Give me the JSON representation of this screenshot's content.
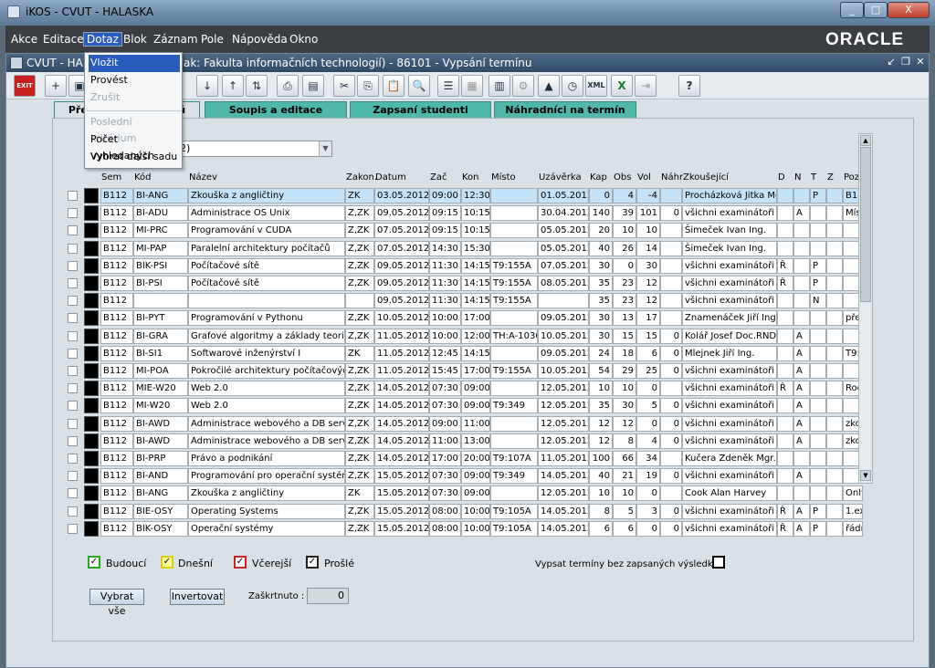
{
  "window": {
    "title": "iKOS - CVUT - HALASKA",
    "min": "_",
    "max": "□",
    "close": "X"
  },
  "menu": [
    "Akce",
    "Editace",
    "Dotaz",
    "Blok",
    "Záznam",
    "Pole",
    "Nápověda",
    "Okno"
  ],
  "brand": "ORACLE",
  "inner": {
    "title": "CVUT - HAL",
    "title2": "ak: Fakulta informačních technologií) - 86101 - Vypsání termínu"
  },
  "tabs": [
    "Přeh",
    "nů",
    "Soupis a editace termínů",
    "Zapsaní studenti",
    "Náhradníci na termín"
  ],
  "dotaz_menu": [
    "Vložit",
    "Provést",
    "Zrušit",
    "Poslední kritérium",
    "Počet vyhledaných",
    "Vybrat další sadu"
  ],
  "combo_value": "2)",
  "columns": [
    "Sem",
    "Kód",
    "Název",
    "Zakon.",
    "Datum",
    "Zač",
    "Kon",
    "Místo",
    "Uzávěrka",
    "Kap",
    "Obs",
    "Vol",
    "Náhr",
    "Zkoušející",
    "D",
    "N",
    "T",
    "Z",
    "Poz"
  ],
  "rows": [
    [
      "B112",
      "BI-ANG",
      "Zkouška z angličtiny",
      "ZK",
      "03.05.2012",
      "09:00",
      "12:30",
      "",
      "01.05.2012",
      "0",
      "4",
      "-4",
      "",
      "Procházková Jitka Mg",
      "",
      "",
      "P",
      "",
      "B1-3"
    ],
    [
      "B112",
      "BI-ADU",
      "Administrace OS Unix",
      "Z,ZK",
      "09.05.2012",
      "09:15",
      "10:15",
      "",
      "30.04.2012",
      "140",
      "39",
      "101",
      "0",
      "všichni examinátoři př",
      "",
      "A",
      "",
      "",
      "Míst"
    ],
    [
      "B112",
      "MI-PRC",
      "Programování v CUDA",
      "Z,ZK",
      "07.05.2012",
      "09:15",
      "10:15",
      "",
      "05.05.2012",
      "20",
      "10",
      "10",
      "",
      "Šimeček Ivan Ing.",
      "",
      "",
      "",
      "",
      ""
    ],
    [
      "B112",
      "MI-PAP",
      "Paralelní architektury počítačů",
      "Z,ZK",
      "07.05.2012",
      "14:30",
      "15:30",
      "",
      "05.05.2012",
      "40",
      "26",
      "14",
      "",
      "Šimeček Ivan Ing.",
      "",
      "",
      "",
      "",
      ""
    ],
    [
      "B112",
      "BIK-PSI",
      "Počítačové sítě",
      "Z,ZK",
      "09.05.2012",
      "11:30",
      "14:15",
      "T9:155A",
      "07.05.2012",
      "30",
      "0",
      "30",
      "",
      "všichni examinátoři př",
      "Ř",
      "",
      "P",
      "",
      ""
    ],
    [
      "B112",
      "BI-PSI",
      "Počítačové sítě",
      "Z,ZK",
      "09.05.2012",
      "11:30",
      "14:15",
      "T9:155A",
      "08.05.2012",
      "35",
      "23",
      "12",
      "",
      "všichni examinátoři př",
      "Ř",
      "",
      "P",
      "",
      ""
    ],
    [
      "B112",
      "",
      "",
      "",
      "09.05.2012",
      "11:30",
      "14:15",
      "T9:155A",
      "",
      "35",
      "23",
      "12",
      "",
      "všichni examinátoři př",
      "",
      "",
      "N",
      "",
      ""
    ],
    [
      "B112",
      "BI-PYT",
      "Programování v Pythonu",
      "Z,ZK",
      "10.05.2012",
      "10:00",
      "17:00",
      "",
      "09.05.2012",
      "30",
      "13",
      "17",
      "",
      "Znamenáček Jiří Ing.",
      "",
      "",
      "",
      "",
      "před"
    ],
    [
      "B112",
      "BI-GRA",
      "Grafové algoritmy a základy teorie",
      "Z,ZK",
      "11.05.2012",
      "10:00",
      "12:00",
      "TH:A-1030",
      "10.05.2012",
      "30",
      "15",
      "15",
      "0",
      "Kolář Josef Doc.RNDr",
      "",
      "A",
      "",
      "",
      ""
    ],
    [
      "B112",
      "BI-SI1",
      "Softwarové inženýrství I",
      "ZK",
      "11.05.2012",
      "12:45",
      "14:15",
      "",
      "09.05.2012",
      "24",
      "18",
      "6",
      "0",
      "Mlejnek Jiří Ing.",
      "",
      "A",
      "",
      "",
      "T9:3"
    ],
    [
      "B112",
      "MI-POA",
      "Pokročilé architektury počítačových",
      "Z,ZK",
      "11.05.2012",
      "15:45",
      "17:00",
      "T9:155A",
      "10.05.2012",
      "54",
      "29",
      "25",
      "0",
      "všichni examinátoři př",
      "",
      "A",
      "",
      "",
      ""
    ],
    [
      "B112",
      "MIE-W20",
      "Web 2.0",
      "Z,ZK",
      "14.05.2012",
      "07:30",
      "09:00",
      "",
      "12.05.2012",
      "10",
      "10",
      "0",
      "",
      "všichni examinátoři př",
      "Ř",
      "A",
      "",
      "",
      "Roo"
    ],
    [
      "B112",
      "MI-W20",
      "Web 2.0",
      "Z,ZK",
      "14.05.2012",
      "07:30",
      "09:00",
      "T9:349",
      "12.05.2012",
      "35",
      "30",
      "5",
      "0",
      "všichni examinátoři př",
      "",
      "A",
      "",
      "",
      ""
    ],
    [
      "B112",
      "BI-AWD",
      "Administrace webového a DB serve",
      "Z,ZK",
      "14.05.2012",
      "09:00",
      "11:00",
      "",
      "12.05.2012",
      "12",
      "12",
      "0",
      "0",
      "všichni examinátoři př",
      "",
      "A",
      "",
      "",
      "zkou"
    ],
    [
      "B112",
      "BI-AWD",
      "Administrace webového a DB serve",
      "Z,ZK",
      "14.05.2012",
      "11:00",
      "13:00",
      "",
      "12.05.2012",
      "12",
      "8",
      "4",
      "0",
      "všichni examinátoři př",
      "",
      "A",
      "",
      "",
      "zkou"
    ],
    [
      "B112",
      "BI-PRP",
      "Právo a podnikání",
      "Z,ZK",
      "14.05.2012",
      "17:00",
      "20:00",
      "T9:107A",
      "11.05.2012",
      "100",
      "66",
      "34",
      "",
      "Kučera Zdeněk Mgr. E",
      "",
      "",
      "",
      "",
      ""
    ],
    [
      "B112",
      "BI-AND",
      "Programování pro operační systém A",
      "Z,ZK",
      "15.05.2012",
      "07:30",
      "09:00",
      "T9:349",
      "14.05.2012",
      "40",
      "21",
      "19",
      "0",
      "všichni examinátoři př",
      "",
      "A",
      "",
      "",
      ""
    ],
    [
      "B112",
      "BI-ANG",
      "Zkouška z angličtiny",
      "ZK",
      "15.05.2012",
      "07:30",
      "09:00",
      "",
      "12.05.2012",
      "10",
      "10",
      "0",
      "",
      "Cook Alan Harvey",
      "",
      "",
      "",
      "",
      "Only"
    ],
    [
      "B112",
      "BIE-OSY",
      "Operating Systems",
      "Z,ZK",
      "15.05.2012",
      "08:00",
      "10:00",
      "T9:105A",
      "14.05.2012",
      "8",
      "5",
      "3",
      "0",
      "všichni examinátoři př",
      "Ř",
      "A",
      "P",
      "",
      "1.ex"
    ],
    [
      "B112",
      "BIK-OSY",
      "Operační systémy",
      "Z,ZK",
      "15.05.2012",
      "08:00",
      "10:00",
      "T9:105A",
      "14.05.2012",
      "6",
      "6",
      "0",
      "0",
      "všichni examinátoři př",
      "Ř",
      "A",
      "P",
      "",
      "řádn"
    ]
  ],
  "legend": [
    {
      "label": "Budoucí",
      "color": "#22aa22"
    },
    {
      "label": "Dnešní",
      "color": "#e8e020"
    },
    {
      "label": "Včerejší",
      "color": "#d02020"
    },
    {
      "label": "Prošlé",
      "color": "#222222"
    }
  ],
  "unsubmitted_label": "Vypsat termíny bez zapsaných výsledků",
  "select_all": "Vybrat vše",
  "invert": "Invertovat",
  "checked_label": "Zaškrtnuto :",
  "checked_value": "0",
  "toolbar_icons": [
    "exit-icon",
    "insert-record-icon",
    "save-icon",
    "sort-asc-icon",
    "sort-desc-icon",
    "sort-icon",
    "print-icon",
    "report-icon",
    "cut-icon",
    "copy-icon",
    "paste-icon",
    "find-icon",
    "list-icon",
    "query-icon",
    "calc-icon",
    "settings-icon",
    "warning-icon",
    "clock-icon",
    "xml-icon",
    "excel-icon",
    "export-icon",
    "help-icon"
  ]
}
